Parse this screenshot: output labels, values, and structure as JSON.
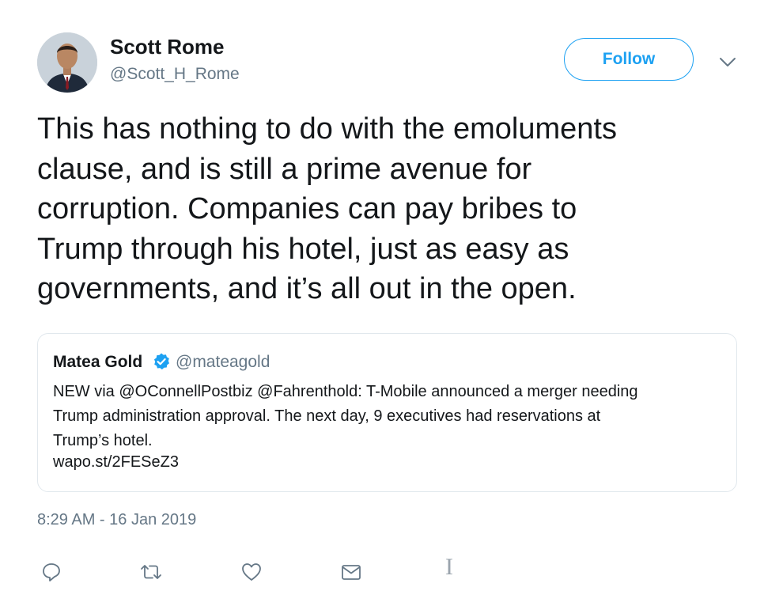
{
  "author": {
    "name": "Scott Rome",
    "handle": "@Scott_H_Rome"
  },
  "follow_button": {
    "label": "Follow"
  },
  "tweet": {
    "text": "This has nothing to do with the emoluments\nclause, and is still a prime avenue for\ncorruption. Companies can pay bribes to\nTrump through his hotel, just as easy as\ngovernments, and it’s all out in the open.",
    "timestamp": "8:29 AM - 16 Jan 2019"
  },
  "quoted_tweet": {
    "name": "Matea Gold",
    "handle": "@mateagold",
    "verified": true,
    "text": "NEW via @OConnellPostbiz @Fahrenthold: T-Mobile announced a merger needing\nTrump administration approval. The next day, 9 executives had reservations at\nTrump’s hotel.",
    "link": "wapo.st/2FESeZ3"
  },
  "actions": [
    {
      "icon": "reply-icon"
    },
    {
      "icon": "retweet-icon"
    },
    {
      "icon": "like-icon"
    },
    {
      "icon": "direct-message-icon"
    }
  ],
  "colors": {
    "accent": "#1da1f2",
    "secondary_text": "#657786",
    "primary_text": "#14171a",
    "border": "#e1e8ed"
  }
}
